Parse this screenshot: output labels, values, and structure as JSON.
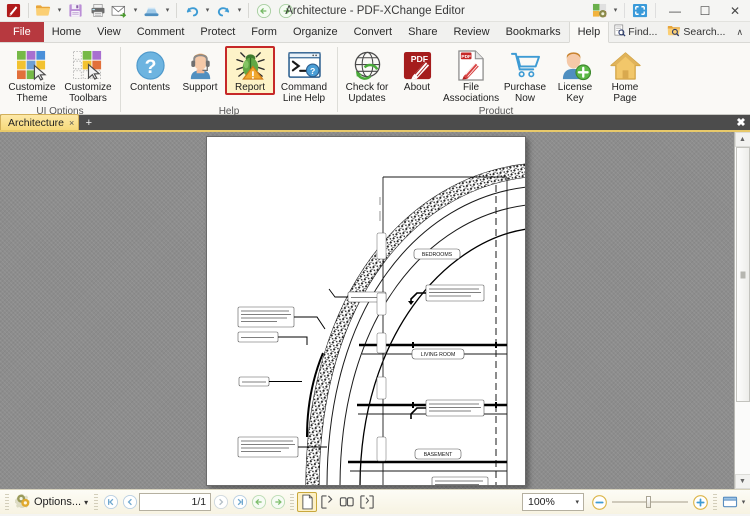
{
  "window": {
    "title": "Architecture - PDF-XChange Editor",
    "minimize_label": "—",
    "maximize_label": "☐",
    "close_label": "✕"
  },
  "quick_access": {
    "items": [
      {
        "name": "app-logo-icon",
        "label": "PDF-XChange Editor",
        "caret": false
      },
      {
        "name": "open-icon",
        "label": "Open",
        "caret": true
      },
      {
        "name": "save-icon",
        "label": "Save",
        "caret": false
      },
      {
        "name": "print-icon",
        "label": "Print",
        "caret": false
      },
      {
        "name": "email-icon",
        "label": "Email",
        "caret": true
      },
      {
        "name": "scan-icon",
        "label": "Scan",
        "caret": true
      },
      {
        "name": "undo-icon",
        "label": "Undo",
        "caret": true
      },
      {
        "name": "redo-icon",
        "label": "Redo",
        "caret": true
      },
      {
        "name": "back-icon",
        "label": "Previous View",
        "caret": false
      },
      {
        "name": "forward-icon",
        "label": "Next View",
        "caret": false
      }
    ],
    "customize_label": "Customize Quick Access Toolbar",
    "fullscreen_label": "Full Screen"
  },
  "menu": {
    "file_label": "File",
    "items": [
      "Home",
      "View",
      "Comment",
      "Protect",
      "Form",
      "Organize",
      "Convert",
      "Share",
      "Review",
      "Bookmarks",
      "Help"
    ],
    "active": "Help",
    "right_items": [
      {
        "label": "Find...",
        "icon": "find-icon"
      },
      {
        "label": "Search...",
        "icon": "search-icon"
      }
    ],
    "collapse_caret": "∧"
  },
  "ribbon": {
    "groups": [
      {
        "label": "UI Options",
        "buttons": [
          {
            "label": "Customize\nTheme",
            "icon": "customize-theme-icon",
            "selected": false
          },
          {
            "label": "Customize\nToolbars",
            "icon": "customize-toolbars-icon",
            "selected": false
          }
        ]
      },
      {
        "label": "Help",
        "buttons": [
          {
            "label": "Contents",
            "icon": "contents-icon",
            "selected": false
          },
          {
            "label": "Support",
            "icon": "support-icon",
            "selected": false
          },
          {
            "label": "Report",
            "icon": "report-bug-icon",
            "selected": true
          },
          {
            "label": "Command\nLine Help",
            "icon": "command-line-help-icon",
            "selected": false
          }
        ]
      },
      {
        "label": "Product",
        "buttons": [
          {
            "label": "Check for\nUpdates",
            "icon": "check-updates-icon",
            "selected": false
          },
          {
            "label": "About",
            "icon": "about-icon",
            "selected": false
          },
          {
            "label": "File\nAssociations",
            "icon": "file-associations-icon",
            "selected": false
          },
          {
            "label": "Purchase\nNow",
            "icon": "purchase-now-icon",
            "selected": false
          },
          {
            "label": "License\nKey",
            "icon": "license-key-icon",
            "selected": false
          },
          {
            "label": "Home\nPage",
            "icon": "home-page-icon",
            "selected": false
          }
        ]
      }
    ]
  },
  "doctabs": {
    "tabs": [
      {
        "label": "Architecture",
        "close": "×",
        "active": true
      }
    ],
    "add_label": "+",
    "close_all_label": "✖"
  },
  "document": {
    "room_labels": [
      "BEDROOMS",
      "LIVING ROOM",
      "BASEMENT"
    ],
    "callouts": [
      "1 INCH TOP RAIL CURVED\nVENEER LAM ARCHED\nBEAM TO MATCH CURVED\nGLAZING",
      "FLOOR JOIST",
      "FORM OFF SET",
      "5/8\" LAYER PLYWOOD\nSHEATHING ON A TOP MOST\nJOIST FLUSH W/ 3/4 RIM"
    ]
  },
  "statusbar": {
    "options_label": "Options...",
    "options_caret": "▾",
    "nav": {
      "first_label": "First Page",
      "prev_label": "Previous Page",
      "page_value": "1/1",
      "next_label": "Next Page",
      "last_label": "Last Page",
      "back_label": "Previous View",
      "forward_label": "Next View"
    },
    "view_modes": [
      {
        "name": "single-page-view",
        "active": true
      },
      {
        "name": "continuous-page-view",
        "active": false
      },
      {
        "name": "two-page-view",
        "active": false
      },
      {
        "name": "two-page-continuous-view",
        "active": false
      }
    ],
    "zoom": {
      "value": "100%",
      "dropdown_caret": "▾",
      "out_label": "Zoom Out",
      "in_label": "Zoom In"
    },
    "layout_btn_label": "Page Layout",
    "layout_caret": "▾"
  },
  "colors": {
    "accent_red": "#b7393f",
    "tab_yellow": "#f6d97a",
    "selection_red": "#c62828",
    "selection_fill": "#fdf3c8",
    "statusbar": "#f7f3e2",
    "doc_bg": "#8d8d8d"
  }
}
